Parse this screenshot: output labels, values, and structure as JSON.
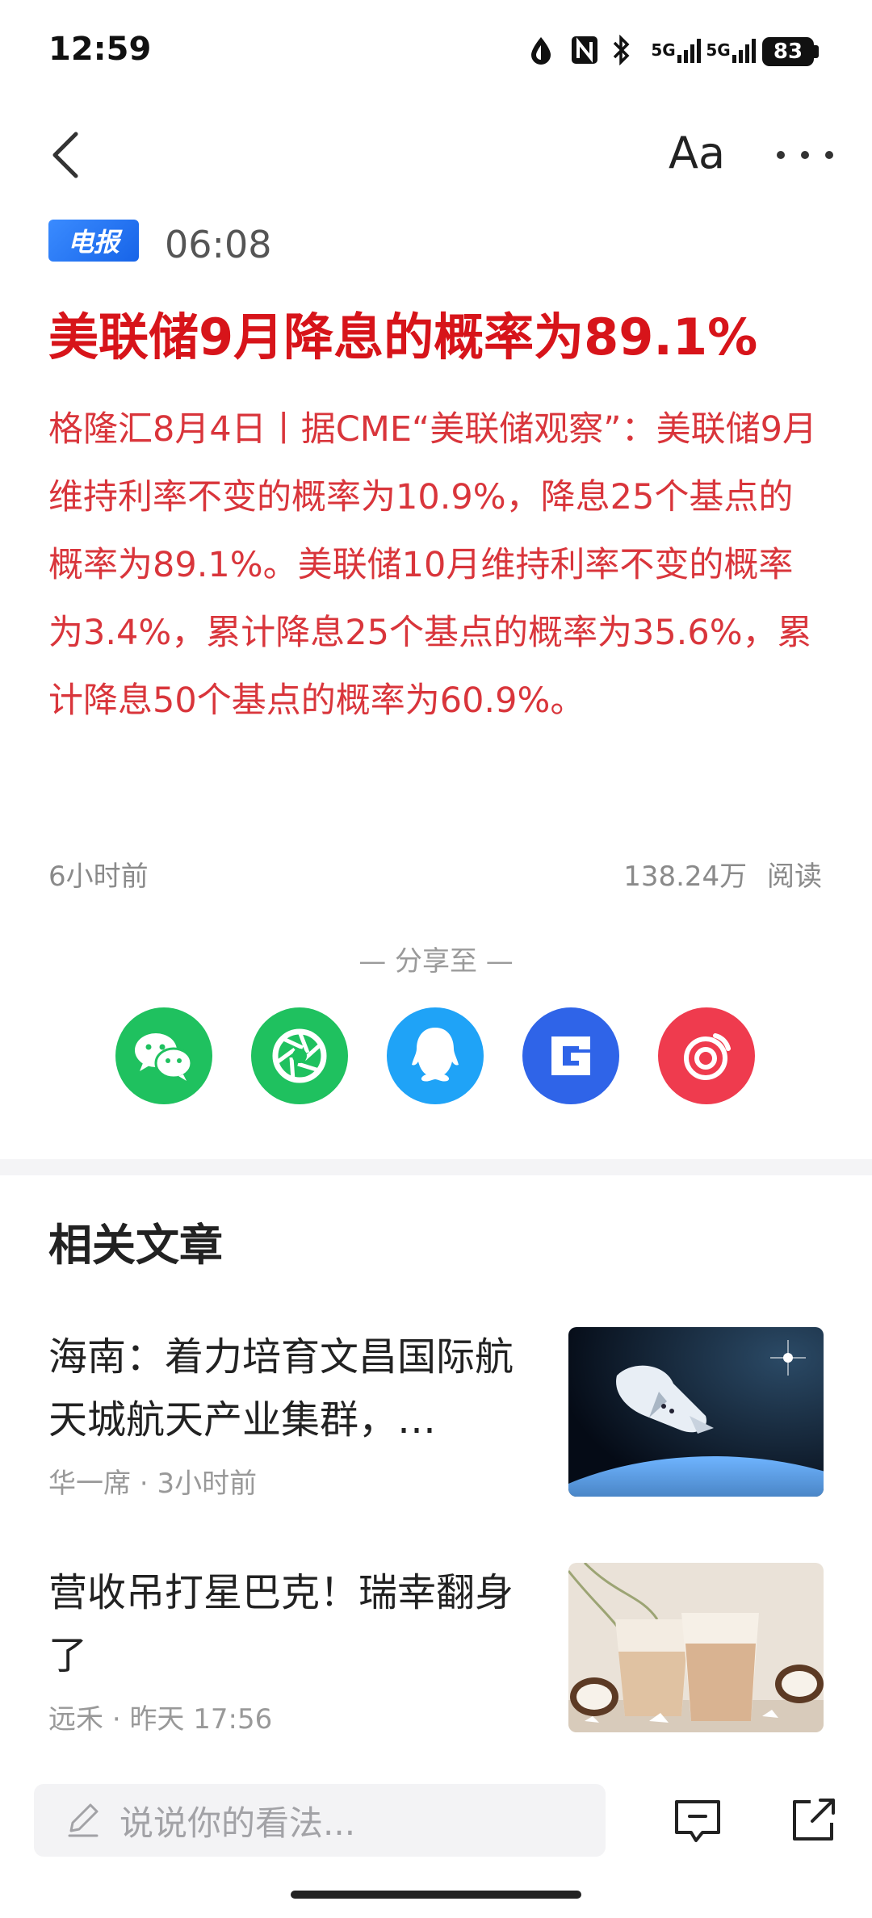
{
  "status_bar": {
    "time": "12:59",
    "network_1": "5G",
    "network_2": "5G",
    "battery": "83"
  },
  "nav": {
    "font_size_label": "Aa"
  },
  "article": {
    "tag": "电报",
    "time": "06:08",
    "headline": "美联储9月降息的概率为89.1%",
    "body": "格隆汇8月4日丨据CME“美联储观察”：美联储9月维持利率不变的概率为10.9%，降息25个基点的概率为89.1%。美联储10月维持利率不变的概率为3.4%，累计降息25个基点的概率为35.6%，累计降息50个基点的概率为60.9%。",
    "time_ago": "6小时前",
    "read_count": "138.24万",
    "read_label": "阅读"
  },
  "share": {
    "label": "— 分享至 —",
    "icons": [
      "wechat-icon",
      "moments-icon",
      "qq-icon",
      "gelonghui-icon",
      "weibo-icon"
    ],
    "colors": [
      "#1fc15f",
      "#1fc15f",
      "#1fa3f7",
      "#2f64e8",
      "#ef3b4e"
    ]
  },
  "related": {
    "title": "相关文章",
    "items": [
      {
        "title": "海南：着力培育文昌国际航天城航天产业集群，…",
        "source": "华一席",
        "time": "3小时前"
      },
      {
        "title": "营收吊打星巴克！瑞幸翻身了",
        "source": "远禾",
        "time": "昨天 17:56"
      }
    ]
  },
  "bottom_bar": {
    "comment_placeholder": "说说你的看法..."
  }
}
